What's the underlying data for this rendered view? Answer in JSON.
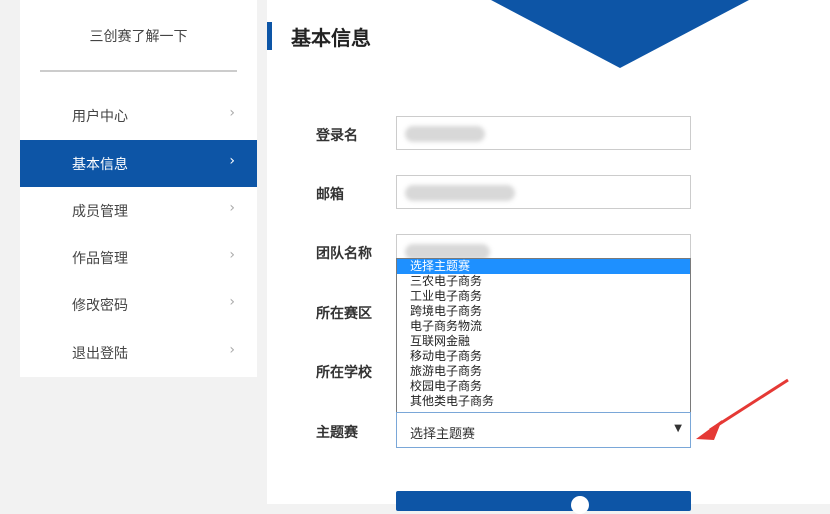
{
  "sidebar": {
    "title": "三创赛了解一下",
    "items": [
      {
        "label": "用户中心",
        "icon": "chevron-right-icon"
      },
      {
        "label": "基本信息",
        "icon": "chevron-right-icon"
      },
      {
        "label": "成员管理",
        "icon": "chevron-right-icon"
      },
      {
        "label": "作品管理",
        "icon": "chevron-right-icon"
      },
      {
        "label": "修改密码",
        "icon": "chevron-right-icon"
      },
      {
        "label": "退出登陆",
        "icon": "chevron-right-icon"
      }
    ],
    "chevron": "›"
  },
  "header": {
    "title": "基本信息"
  },
  "form": {
    "login_label": "登录名",
    "email_label": "邮箱",
    "team_label": "团队名称",
    "region_label": "所在赛区",
    "school_label": "所在学校",
    "theme_label": "主题赛"
  },
  "dropdown": {
    "options": [
      "选择主题赛",
      "三农电子商务",
      "工业电子商务",
      "跨境电子商务",
      "电子商务物流",
      "互联网金融",
      "移动电子商务",
      "旅游电子商务",
      "校园电子商务",
      "其他类电子商务"
    ],
    "selected_value": "选择主题赛",
    "arrow": "▼"
  },
  "colors": {
    "accent": "#0d55a6",
    "highlight": "#1e90ff",
    "annotation": "#e53935"
  }
}
